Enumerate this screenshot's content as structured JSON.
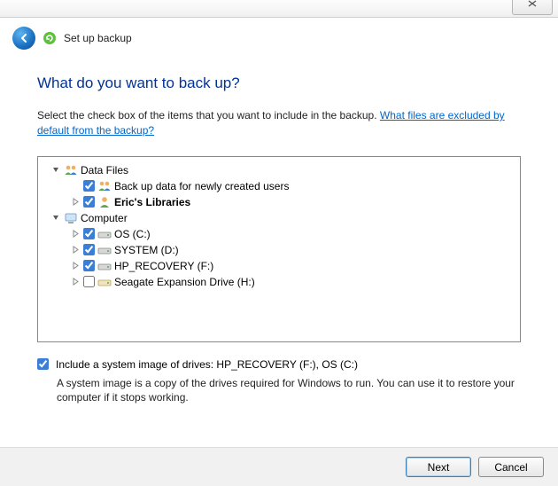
{
  "header": {
    "title": "Set up backup"
  },
  "main": {
    "heading": "What do you want to back up?",
    "instruction_prefix": "Select the check box of the items that you want to include in the backup. ",
    "instruction_link": "What files are excluded by default from the backup?"
  },
  "tree": {
    "data_files": {
      "label": "Data Files"
    },
    "new_users": {
      "label": "Back up data for newly created users"
    },
    "erics_libraries": {
      "label": "Eric's Libraries"
    },
    "computer": {
      "label": "Computer"
    },
    "os_c": {
      "label": "OS (C:)"
    },
    "system_d": {
      "label": "SYSTEM (D:)"
    },
    "hp_recovery": {
      "label": "HP_RECOVERY (F:)"
    },
    "seagate": {
      "label": "Seagate Expansion Drive (H:)"
    }
  },
  "system_image": {
    "label": "Include a system image of drives: HP_RECOVERY (F:), OS (C:)",
    "description": "A system image is a copy of the drives required for Windows to run. You can use it to restore your computer if it stops working."
  },
  "footer": {
    "next": "Next",
    "cancel": "Cancel"
  }
}
